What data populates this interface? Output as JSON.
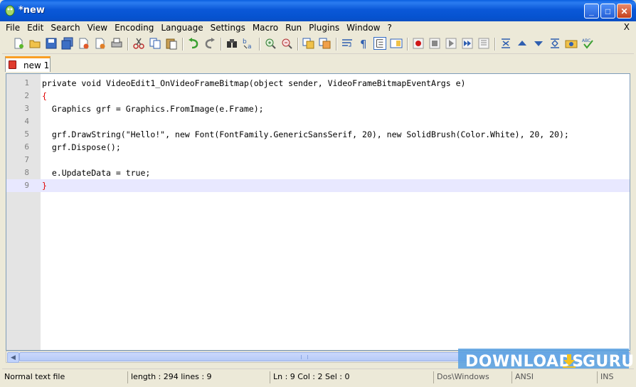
{
  "window": {
    "title": "*new"
  },
  "title_buttons": {
    "minimize": "_",
    "maximize": "□",
    "close": "✕"
  },
  "menu": [
    "File",
    "Edit",
    "Search",
    "View",
    "Encoding",
    "Language",
    "Settings",
    "Macro",
    "Run",
    "Plugins",
    "Window",
    "?"
  ],
  "menu_close": "X",
  "toolbar_icons": [
    "new-file-icon",
    "open-file-icon",
    "save-icon",
    "save-all-icon",
    "close-icon",
    "close-all-icon",
    "print-icon",
    "cut-icon",
    "copy-icon",
    "paste-icon",
    "undo-icon",
    "redo-icon",
    "find-icon",
    "replace-icon",
    "zoom-in-icon",
    "zoom-out-icon",
    "sync-vertical-icon",
    "sync-horizontal-icon",
    "word-wrap-icon",
    "show-all-chars-icon",
    "indent-guide-icon",
    "document-map-icon",
    "record-macro-icon",
    "stop-recording-icon",
    "play-macro-icon",
    "run-macro-multiple-icon",
    "save-macro-icon",
    "fold-all-icon",
    "up-icon",
    "down-icon",
    "unfold-icon",
    "launch-browser-icon",
    "spell-check-icon"
  ],
  "tab": {
    "label": "new  1"
  },
  "editor": {
    "lines": [
      {
        "num": "1",
        "text": "private void VideoEdit1_OnVideoFrameBitmap(object sender, VideoFrameBitmapEventArgs e)"
      },
      {
        "num": "2",
        "text": "{"
      },
      {
        "num": "3",
        "text": "  Graphics grf = Graphics.FromImage(e.Frame);"
      },
      {
        "num": "4",
        "text": ""
      },
      {
        "num": "5",
        "text": "  grf.DrawString(\"Hello!\", new Font(FontFamily.GenericSansSerif, 20), new SolidBrush(Color.White), 20, 20);"
      },
      {
        "num": "6",
        "text": "  grf.Dispose();"
      },
      {
        "num": "7",
        "text": ""
      },
      {
        "num": "8",
        "text": "  e.UpdateData = true;"
      },
      {
        "num": "9",
        "text": "}"
      }
    ],
    "current_line": 9
  },
  "status": {
    "file_type": "Normal text file",
    "length": "length : 294    lines : 9",
    "position": "Ln : 9    Col : 2    Sel : 0",
    "eol": "Dos\\Windows",
    "encoding": "ANSI",
    "mode": "INS"
  },
  "watermark": {
    "text_left": "DOWNLOADS",
    "text_right": ".GURU"
  },
  "colors": {
    "title_blue": "#0653d0",
    "tab_accent": "#fa9f24",
    "current_line": "#e8e8ff",
    "brace": "#e00000"
  }
}
